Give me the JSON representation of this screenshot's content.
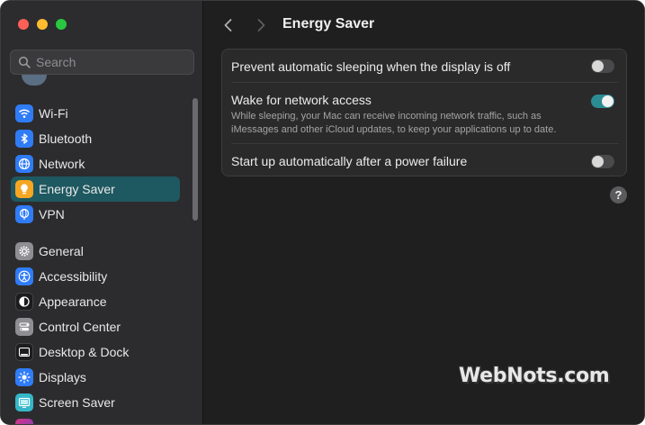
{
  "window": {
    "title": "Energy Saver"
  },
  "search": {
    "placeholder": "Search",
    "value": ""
  },
  "sidebar": {
    "items": [
      {
        "label": "Wi-Fi",
        "icon": "wifi-icon",
        "color": "#2f7cf6",
        "active": false
      },
      {
        "label": "Bluetooth",
        "icon": "bluetooth-icon",
        "color": "#2f7cf6",
        "active": false
      },
      {
        "label": "Network",
        "icon": "globe-icon",
        "color": "#2f7cf6",
        "active": false
      },
      {
        "label": "Energy Saver",
        "icon": "lightbulb-icon",
        "color": "#f5a623",
        "active": true
      },
      {
        "label": "VPN",
        "icon": "vpn-globe-icon",
        "color": "#2f7cf6",
        "active": false
      },
      {
        "label": "General",
        "icon": "gear-icon",
        "color": "#8e8e93",
        "active": false
      },
      {
        "label": "Accessibility",
        "icon": "accessibility-icon",
        "color": "#2f7cf6",
        "active": false
      },
      {
        "label": "Appearance",
        "icon": "appearance-icon",
        "color": "#1c1c1e",
        "active": false
      },
      {
        "label": "Control Center",
        "icon": "control-center-icon",
        "color": "#8e8e93",
        "active": false
      },
      {
        "label": "Desktop & Dock",
        "icon": "dock-icon",
        "color": "#1c1c1e",
        "active": false
      },
      {
        "label": "Displays",
        "icon": "sun-icon",
        "color": "#2f7cf6",
        "active": false
      },
      {
        "label": "Screen Saver",
        "icon": "screen-saver-icon",
        "color": "#36b7c9",
        "active": false
      }
    ]
  },
  "settings": {
    "prevent_sleep": {
      "title": "Prevent automatic sleeping when the display is off",
      "on": false
    },
    "wake_network": {
      "title": "Wake for network access",
      "description": "While sleeping, your Mac can receive incoming network traffic, such as iMessages and other iCloud updates, to keep your applications up to date.",
      "on": true
    },
    "startup_power": {
      "title": "Start up automatically after a power failure",
      "on": false
    }
  },
  "help": {
    "label": "?"
  },
  "watermark": {
    "text": "WebNots.com"
  },
  "colors": {
    "accent": "#2c8c94",
    "selection": "#1e5860"
  }
}
